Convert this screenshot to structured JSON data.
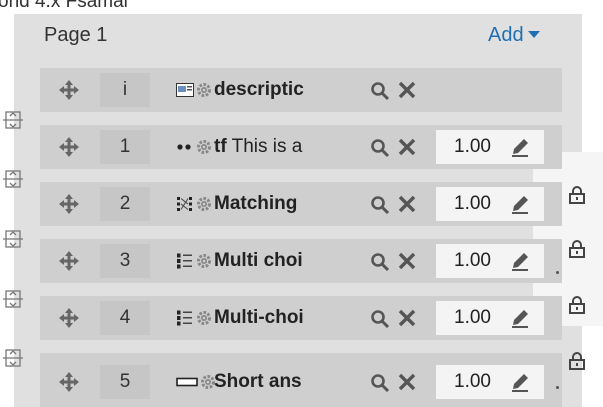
{
  "top_text": "ond 4.x Fsamal",
  "section": {
    "title": "Page 1",
    "add_label": "Add"
  },
  "questions": [
    {
      "number": "i",
      "name": "descriptic",
      "text": "",
      "type_icon": "description-icon",
      "mark": null
    },
    {
      "number": "1",
      "name": "tf",
      "text": "This is a",
      "type_icon": "truefalse-icon",
      "mark": "1.00"
    },
    {
      "number": "2",
      "name": "Matching",
      "text": "",
      "type_icon": "matching-icon",
      "mark": "1.00"
    },
    {
      "number": "3",
      "name": "Multi choi",
      "text": "",
      "type_icon": "multichoice-icon",
      "mark": "1.00"
    },
    {
      "number": "4",
      "name": "Multi-choi",
      "text": "",
      "type_icon": "multichoice-icon",
      "mark": "1.00"
    },
    {
      "number": "5",
      "name": "Short ans",
      "text": "",
      "type_icon": "shortanswer-icon",
      "mark": "1.00"
    }
  ],
  "colors": {
    "accent": "#1f6fb2",
    "panel": "#e0e0e0",
    "row": "#cfcfcf",
    "badge": "#c6c6c6"
  }
}
